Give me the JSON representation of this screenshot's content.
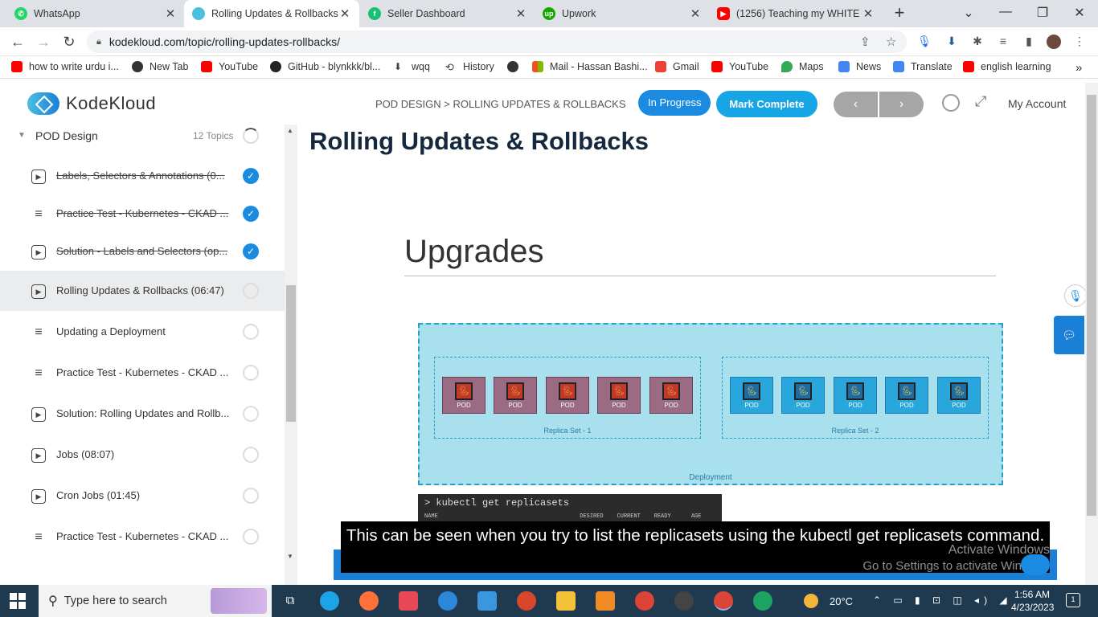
{
  "browser": {
    "tabs": [
      {
        "label": "WhatsApp",
        "icon": "whatsapp-icon",
        "color": "#25d366",
        "active": false
      },
      {
        "label": "Rolling Updates & Rollbacks",
        "icon": "kodekloud-icon",
        "color": "#4ac0e0",
        "active": true
      },
      {
        "label": "Seller Dashboard",
        "icon": "fiverr-icon",
        "color": "#1dbf73",
        "active": false
      },
      {
        "label": "Upwork",
        "icon": "upwork-icon",
        "color": "#14a800",
        "active": false
      },
      {
        "label": "(1256) Teaching my WHITE fr",
        "icon": "youtube-icon",
        "color": "#ff0000",
        "active": false
      }
    ],
    "url": "kodekloud.com/topic/rolling-updates-rollbacks/",
    "bookmarks": [
      {
        "label": "how to write urdu i...",
        "color": "#ff0000"
      },
      {
        "label": "New Tab",
        "color": "#333333"
      },
      {
        "label": "YouTube",
        "color": "#ff0000"
      },
      {
        "label": "GitHub - blynkkk/bl...",
        "color": "#222222"
      },
      {
        "label": "wqq",
        "color": "#444444"
      },
      {
        "label": "History",
        "color": "#444444"
      },
      {
        "label": "",
        "color": "#333333"
      },
      {
        "label": "Mail - Hassan Bashi...",
        "color": "#f25022"
      },
      {
        "label": "Gmail",
        "color": "#ea4335"
      },
      {
        "label": "YouTube",
        "color": "#ff0000"
      },
      {
        "label": "Maps",
        "color": "#34a853"
      },
      {
        "label": "News",
        "color": "#4285f4"
      },
      {
        "label": "Translate",
        "color": "#4285f4"
      },
      {
        "label": "english learning",
        "color": "#ff0000"
      }
    ],
    "more_bookmarks": "»"
  },
  "site": {
    "logo_text": "KodeKloud",
    "breadcrumb": "POD DESIGN > ROLLING UPDATES & ROLLBACKS",
    "status_label": "In Progress",
    "mark_complete_label": "Mark Complete",
    "prev_label": "‹",
    "next_label": "›",
    "account_label": "My Account"
  },
  "sidebar": {
    "section_title": "POD Design",
    "section_count": "12 Topics",
    "items": [
      {
        "label": "Labels, Selectors & Annotations (0...",
        "type": "video",
        "done": true
      },
      {
        "label": "Practice Test - Kubernetes - CKAD ...",
        "type": "list",
        "done": true
      },
      {
        "label": "Solution - Labels and Selectors (op...",
        "type": "video",
        "done": true
      },
      {
        "label": "Rolling Updates & Rollbacks (06:47)",
        "type": "video",
        "done": false,
        "selected": true
      },
      {
        "label": "Updating a Deployment",
        "type": "list",
        "done": false
      },
      {
        "label": "Practice Test - Kubernetes - CKAD ...",
        "type": "list",
        "done": false
      },
      {
        "label": "Solution: Rolling Updates and Rollb...",
        "type": "video",
        "done": false
      },
      {
        "label": "Jobs (08:07)",
        "type": "video",
        "done": false
      },
      {
        "label": "Cron Jobs (01:45)",
        "type": "video",
        "done": false
      },
      {
        "label": "Practice Test - Kubernetes - CKAD ...",
        "type": "list",
        "done": false
      }
    ]
  },
  "lesson": {
    "title": "Rolling Updates & Rollbacks",
    "slide_title": "Upgrades",
    "deployment_label": "Deployment",
    "replica_set_1": "Replica Set - 1",
    "replica_set_2": "Replica Set - 2",
    "pod_label": "POD",
    "terminal_command": "> kubectl get replicasets",
    "terminal_headers": "NAME                                          DESIRED    CURRENT    READY      AGE",
    "caption": "This can be seen when you try to list the replicasets using the kubectl get replicasets command.",
    "watermark_line1": "Activate Windows",
    "watermark_line2": "Go to Settings to activate Windows"
  },
  "taskbar": {
    "search_placeholder": "Type here to search",
    "weather": "20°C",
    "time": "1:56 AM",
    "date": "4/23/2023",
    "notification_count": "1"
  }
}
